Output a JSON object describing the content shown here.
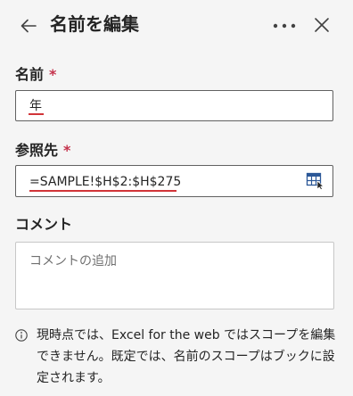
{
  "header": {
    "title": "名前を編集",
    "back_icon": "arrow-left-icon",
    "more_icon": "more-horizontal-icon",
    "close_icon": "close-icon"
  },
  "name_field": {
    "label": "名前",
    "required_mark": "*",
    "value": "年"
  },
  "reference_field": {
    "label": "参照先",
    "required_mark": "*",
    "value": "=SAMPLE!$H$2:$H$275",
    "range_select_icon": "select-range-icon"
  },
  "comment_field": {
    "label": "コメント",
    "placeholder": "コメントの追加",
    "value": ""
  },
  "info": {
    "icon": "info-icon",
    "text": "現時点では、Excel for the web ではスコープを編集できません。既定では、名前のスコープはブックに設定されます。"
  },
  "colors": {
    "required": "#c4314b",
    "spellcheck_underline": "#d13438",
    "background": "#f5f5f5",
    "field_border": "#616161"
  }
}
